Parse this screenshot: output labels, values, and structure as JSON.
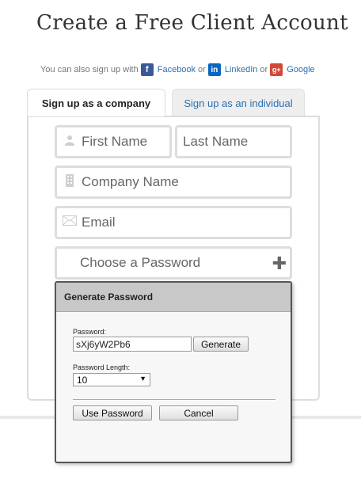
{
  "header": {
    "title": "Create a Free Client Account"
  },
  "social": {
    "prefix": "You can also sign up with",
    "facebook": "Facebook",
    "or1": "or",
    "linkedin": "LinkedIn",
    "or2": "or",
    "google": "Google",
    "facebook_icon": "f",
    "linkedin_icon": "in",
    "google_icon": "g+"
  },
  "tabs": {
    "company": "Sign up as a company",
    "individual": "Sign up as an individual"
  },
  "form": {
    "first_name_placeholder": "First Name",
    "last_name_placeholder": "Last Name",
    "company_placeholder": "Company Name",
    "email_placeholder": "Email",
    "password_placeholder": "Choose a Password"
  },
  "generator": {
    "title": "Generate Password",
    "password_label": "Password:",
    "password_value": "sXj6yW2Pb6",
    "generate_button": "Generate",
    "length_label": "Password Length:",
    "length_value": "10",
    "use_button": "Use Password",
    "cancel_button": "Cancel"
  },
  "colors": {
    "link": "#2a6fb3",
    "facebook": "#3b5998",
    "linkedin": "#0a66c2",
    "google": "#d34836",
    "field_border": "#dddddd"
  }
}
